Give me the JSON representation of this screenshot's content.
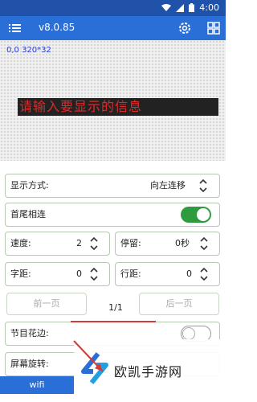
{
  "status": {
    "time": "4:00"
  },
  "appbar": {
    "title": "v8.0.85",
    "menu_icon": "menu-icon",
    "settings_icon": "gear-icon",
    "grid_icon": "grid-icon"
  },
  "preview": {
    "coord_label": "0,0 320*32",
    "led_text": "请输入要显示的信息"
  },
  "settings": {
    "display_mode_label": "显示方式:",
    "display_mode_value": "向左连移",
    "loop_label": "首尾相连",
    "loop_on": true,
    "speed_label": "速度:",
    "speed_value": "2",
    "pause_label": "停留:",
    "pause_value": "0秒",
    "char_spacing_label": "字距:",
    "char_spacing_value": "0",
    "line_spacing_label": "行距:",
    "line_spacing_value": "0",
    "prev_page": "前一页",
    "next_page": "后一页",
    "page_indicator": "1/1",
    "border_label": "节目花边:",
    "border_on": false,
    "rotate_label": "屏幕旋转:"
  },
  "bottom": {
    "wifi_label": "wifi"
  },
  "watermark": {
    "text": "欧凯手游网"
  },
  "colors": {
    "status_bar": "#1f52a8",
    "app_bar": "#2a6ed8",
    "led_text": "#e02a2a",
    "toggle_on": "#2e9c3e"
  }
}
